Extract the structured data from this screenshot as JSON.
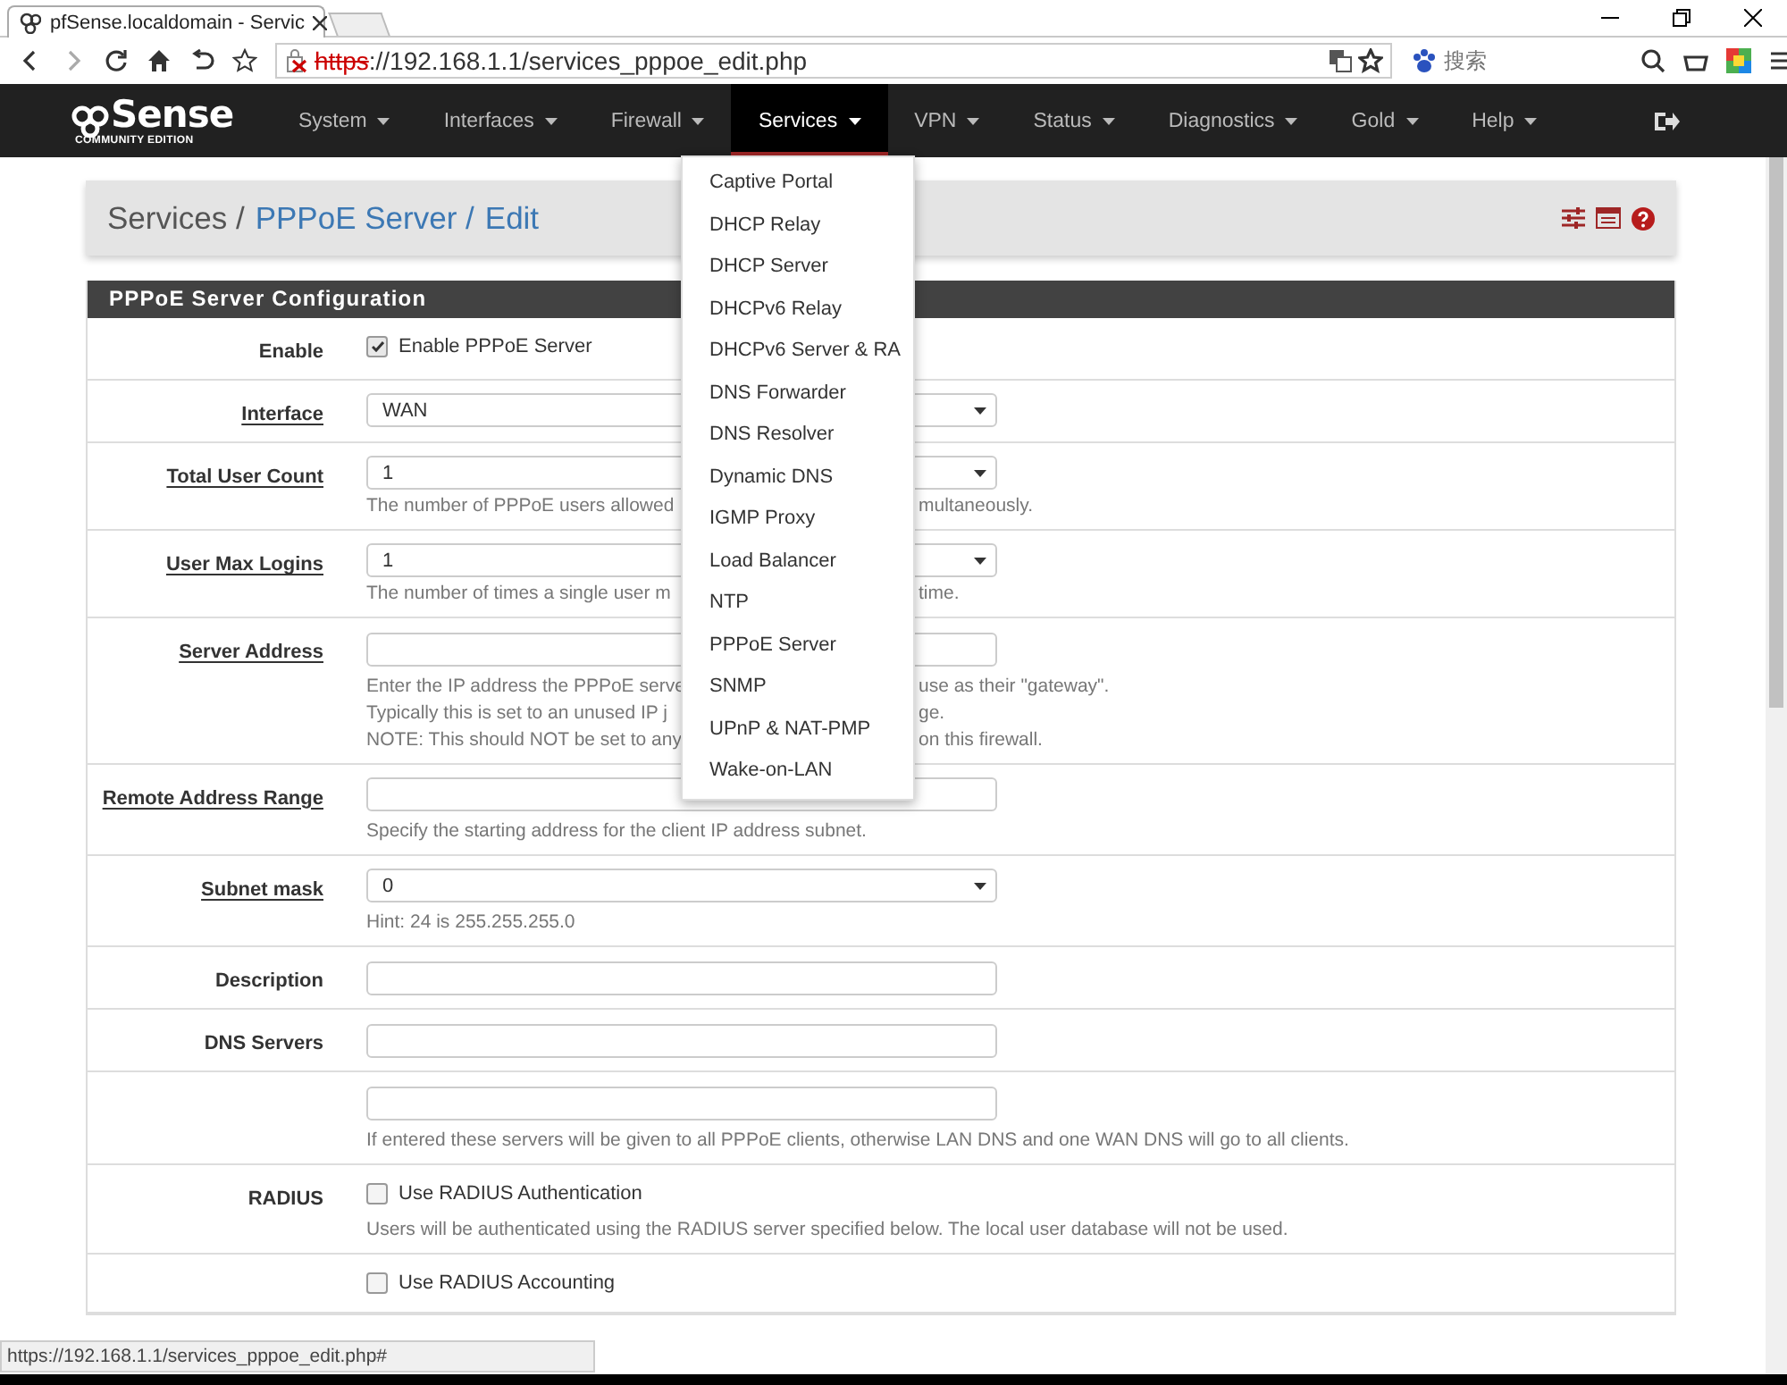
{
  "browser": {
    "tab_title": "pfSense.localdomain - Servic",
    "url_scheme": "https",
    "url_rest": "://192.168.1.1/services_pppoe_edit.php",
    "search_placeholder": "搜索",
    "status_url": "https://192.168.1.1/services_pppoe_edit.php#"
  },
  "navbar": {
    "logo": "Sense",
    "logo_subtitle": "COMMUNITY EDITION",
    "items": [
      {
        "label": "System",
        "selected": false
      },
      {
        "label": "Interfaces",
        "selected": false
      },
      {
        "label": "Firewall",
        "selected": false
      },
      {
        "label": "Services",
        "selected": true
      },
      {
        "label": "VPN",
        "selected": false
      },
      {
        "label": "Status",
        "selected": false
      },
      {
        "label": "Diagnostics",
        "selected": false
      },
      {
        "label": "Gold",
        "selected": false
      },
      {
        "label": "Help",
        "selected": false
      }
    ]
  },
  "services_menu": {
    "items": [
      "Captive Portal",
      "DHCP Relay",
      "DHCP Server",
      "DHCPv6 Relay",
      "DHCPv6 Server & RA",
      "DNS Forwarder",
      "DNS Resolver",
      "Dynamic DNS",
      "IGMP Proxy",
      "Load Balancer",
      "NTP",
      "PPPoE Server",
      "SNMP",
      "UPnP & NAT-PMP",
      "Wake-on-LAN"
    ]
  },
  "breadcrumb": [
    {
      "label": "Services /",
      "kind": "text"
    },
    {
      "label": "PPPoE Server /",
      "kind": "link"
    },
    {
      "label": "Edit",
      "kind": "link"
    }
  ],
  "panel": {
    "title": "PPPoE Server Configuration",
    "rows": [
      {
        "label": "Enable",
        "help": false,
        "kind": "checkbox",
        "checked": true,
        "text": "Enable PPPoE Server"
      },
      {
        "label": "Interface",
        "help": true,
        "kind": "select",
        "value": "WAN"
      },
      {
        "label": "Total User Count",
        "help": true,
        "kind": "select",
        "value": "1",
        "hint_lines": [
          {
            "text": "The number of PPPoE users allowed",
            "after_menu": "multaneously."
          }
        ]
      },
      {
        "label": "User Max Logins",
        "help": true,
        "kind": "select",
        "value": "1",
        "hint_lines": [
          {
            "text": "The number of times a single user m",
            "after_menu": "time."
          }
        ]
      },
      {
        "label": "Server Address",
        "help": true,
        "kind": "input",
        "hint_lines": [
          {
            "text": "Enter the IP address the PPPoE serve",
            "after_menu": "use as their \"gateway\"."
          },
          {
            "text": "Typically this is set to an unused IP j",
            "after_menu": "ge."
          },
          {
            "text": "NOTE: This should NOT be set to any",
            "after_menu": "on this firewall."
          }
        ]
      },
      {
        "label": "Remote Address Range",
        "help": true,
        "kind": "input",
        "hint_lines": [
          {
            "text": "Specify the starting address for the client IP address subnet."
          }
        ]
      },
      {
        "label": "Subnet mask",
        "help": true,
        "kind": "select",
        "value": "0",
        "hint_lines": [
          {
            "text": "Hint: 24 is 255.255.255.0"
          }
        ]
      },
      {
        "label": "Description",
        "help": false,
        "kind": "input"
      },
      {
        "label": "DNS Servers",
        "help": false,
        "kind": "input"
      },
      {
        "kind": "input",
        "hint_lines": [
          {
            "text": "If entered these servers will be given to all PPPoE clients, otherwise LAN DNS and one WAN DNS will go to all clients."
          }
        ]
      },
      {
        "label": "RADIUS",
        "help": false,
        "kind": "checkbox",
        "checked": false,
        "text": "Use RADIUS Authentication",
        "hint_lines": [
          {
            "text": "Users will be authenticated using the RADIUS server specified below. The local user database will not be used."
          }
        ]
      },
      {
        "kind": "checkbox",
        "checked": false,
        "text": "Use RADIUS Accounting"
      }
    ]
  }
}
